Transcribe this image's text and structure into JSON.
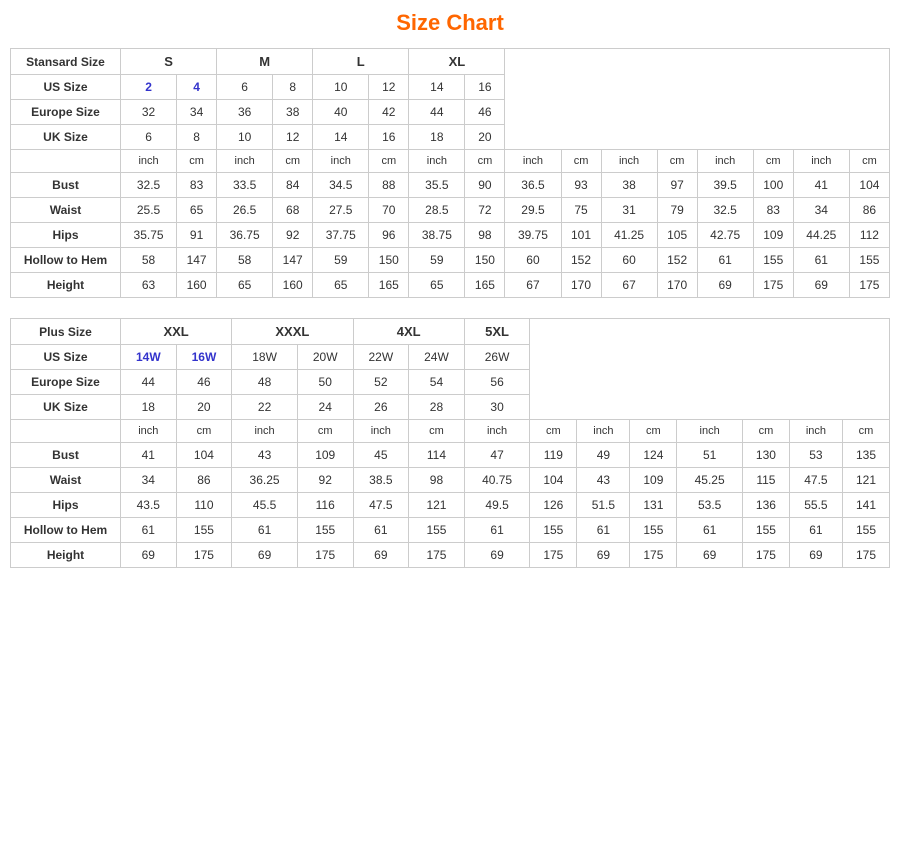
{
  "title": "Size Chart",
  "standard": {
    "sectionLabel": "Stansard Size",
    "sizes": [
      "S",
      "M",
      "L",
      "XL"
    ],
    "sizeSpans": [
      2,
      2,
      2,
      2
    ],
    "usSize": {
      "label": "US Size",
      "values": [
        "2",
        "4",
        "6",
        "8",
        "10",
        "12",
        "14",
        "16"
      ]
    },
    "europeSize": {
      "label": "Europe Size",
      "values": [
        "32",
        "34",
        "36",
        "38",
        "40",
        "42",
        "44",
        "46"
      ]
    },
    "ukSize": {
      "label": "UK Size",
      "values": [
        "6",
        "8",
        "10",
        "12",
        "14",
        "16",
        "18",
        "20"
      ]
    },
    "subHeaders": [
      "inch",
      "cm",
      "inch",
      "cm",
      "inch",
      "cm",
      "inch",
      "cm",
      "inch",
      "cm",
      "inch",
      "cm",
      "inch",
      "cm",
      "inch",
      "cm"
    ],
    "measurements": {
      "bust": {
        "label": "Bust",
        "values": [
          "32.5",
          "83",
          "33.5",
          "84",
          "34.5",
          "88",
          "35.5",
          "90",
          "36.5",
          "93",
          "38",
          "97",
          "39.5",
          "100",
          "41",
          "104"
        ]
      },
      "waist": {
        "label": "Waist",
        "values": [
          "25.5",
          "65",
          "26.5",
          "68",
          "27.5",
          "70",
          "28.5",
          "72",
          "29.5",
          "75",
          "31",
          "79",
          "32.5",
          "83",
          "34",
          "86"
        ]
      },
      "hips": {
        "label": "Hips",
        "values": [
          "35.75",
          "91",
          "36.75",
          "92",
          "37.75",
          "96",
          "38.75",
          "98",
          "39.75",
          "101",
          "41.25",
          "105",
          "42.75",
          "109",
          "44.25",
          "112"
        ]
      },
      "hollowToHem": {
        "label": "Hollow to Hem",
        "values": [
          "58",
          "147",
          "58",
          "147",
          "59",
          "150",
          "59",
          "150",
          "60",
          "152",
          "60",
          "152",
          "61",
          "155",
          "61",
          "155"
        ]
      },
      "height": {
        "label": "Height",
        "values": [
          "63",
          "160",
          "65",
          "160",
          "65",
          "165",
          "65",
          "165",
          "67",
          "170",
          "67",
          "170",
          "69",
          "175",
          "69",
          "175"
        ]
      }
    }
  },
  "plus": {
    "sectionLabel": "Plus Size",
    "sizes": [
      "XXL",
      "XXXL",
      "4XL",
      "5XL"
    ],
    "sizeSpans": [
      2,
      2,
      2,
      1
    ],
    "usSize": {
      "label": "US Size",
      "values": [
        "14W",
        "16W",
        "18W",
        "20W",
        "22W",
        "24W",
        "26W"
      ]
    },
    "europeSize": {
      "label": "Europe Size",
      "values": [
        "44",
        "46",
        "48",
        "50",
        "52",
        "54",
        "56"
      ]
    },
    "ukSize": {
      "label": "UK Size",
      "values": [
        "18",
        "20",
        "22",
        "24",
        "26",
        "28",
        "30"
      ]
    },
    "subHeaders": [
      "inch",
      "cm",
      "inch",
      "cm",
      "inch",
      "cm",
      "inch",
      "cm",
      "inch",
      "cm",
      "inch",
      "cm",
      "inch",
      "cm"
    ],
    "measurements": {
      "bust": {
        "label": "Bust",
        "values": [
          "41",
          "104",
          "43",
          "109",
          "45",
          "114",
          "47",
          "119",
          "49",
          "124",
          "51",
          "130",
          "53",
          "135"
        ]
      },
      "waist": {
        "label": "Waist",
        "values": [
          "34",
          "86",
          "36.25",
          "92",
          "38.5",
          "98",
          "40.75",
          "104",
          "43",
          "109",
          "45.25",
          "115",
          "47.5",
          "121"
        ]
      },
      "hips": {
        "label": "Hips",
        "values": [
          "43.5",
          "110",
          "45.5",
          "116",
          "47.5",
          "121",
          "49.5",
          "126",
          "51.5",
          "131",
          "53.5",
          "136",
          "55.5",
          "141"
        ]
      },
      "hollowToHem": {
        "label": "Hollow to Hem",
        "values": [
          "61",
          "155",
          "61",
          "155",
          "61",
          "155",
          "61",
          "155",
          "61",
          "155",
          "61",
          "155",
          "61",
          "155"
        ]
      },
      "height": {
        "label": "Height",
        "values": [
          "69",
          "175",
          "69",
          "175",
          "69",
          "175",
          "69",
          "175",
          "69",
          "175",
          "69",
          "175",
          "69",
          "175"
        ]
      }
    }
  }
}
